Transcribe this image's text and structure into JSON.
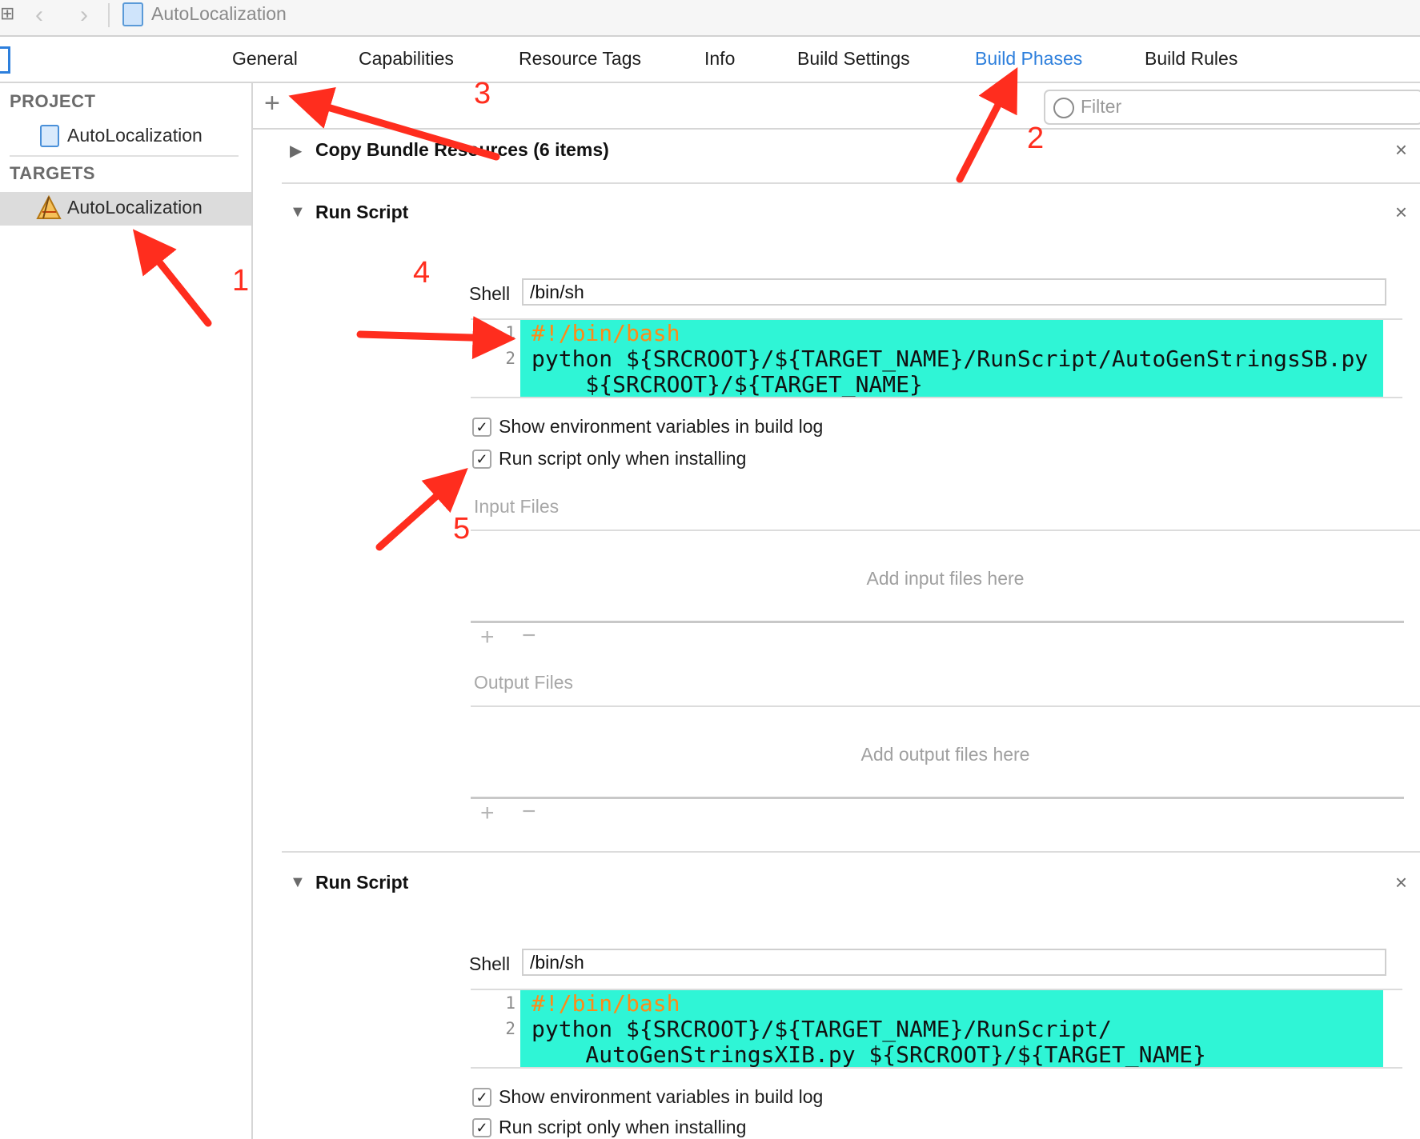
{
  "toolbar": {
    "document_title": "AutoLocalization"
  },
  "tabs": [
    {
      "label": "General"
    },
    {
      "label": "Capabilities"
    },
    {
      "label": "Resource Tags"
    },
    {
      "label": "Info"
    },
    {
      "label": "Build Settings"
    },
    {
      "label": "Build Phases",
      "active": true
    },
    {
      "label": "Build Rules"
    }
  ],
  "sidebar": {
    "project_header": "PROJECT",
    "project_item": "AutoLocalization",
    "targets_header": "TARGETS",
    "target_item": "AutoLocalization"
  },
  "phases_toolbar": {
    "filter_placeholder": "Filter"
  },
  "phases": [
    {
      "title": "Copy Bundle Resources (6 items)",
      "expanded": false
    },
    {
      "title": "Run Script",
      "expanded": true,
      "shell_label": "Shell",
      "shell_value": "/bin/sh",
      "line_numbers": [
        "1",
        "2"
      ],
      "code_lines": [
        "#!/bin/bash",
        "python ${SRCROOT}/${TARGET_NAME}/RunScript/AutoGenStringsSB.py",
        "    ${SRCROOT}/${TARGET_NAME}"
      ],
      "show_env_label": "Show environment variables in build log",
      "show_env_checked": true,
      "install_only_label": "Run script only when installing",
      "install_only_checked": true,
      "input_files_label": "Input Files",
      "input_files_hint": "Add input files here",
      "output_files_label": "Output Files",
      "output_files_hint": "Add output files here"
    },
    {
      "title": "Run Script",
      "expanded": true,
      "shell_label": "Shell",
      "shell_value": "/bin/sh",
      "line_numbers": [
        "1",
        "2"
      ],
      "code_lines": [
        "#!/bin/bash",
        "python ${SRCROOT}/${TARGET_NAME}/RunScript/",
        "    AutoGenStringsXIB.py ${SRCROOT}/${TARGET_NAME}"
      ],
      "show_env_label": "Show environment variables in build log",
      "show_env_checked": true,
      "install_only_label": "Run script only when installing",
      "install_only_checked": true
    }
  ],
  "annotations": [
    "1",
    "2",
    "3",
    "4",
    "5"
  ],
  "colors": {
    "accent": "#2d7fdc",
    "annotation": "#ff2d1e",
    "code_bg": "#2ff5d6",
    "comment": "#ff8a17"
  },
  "icons": [
    "grid-icon",
    "back-chevron-icon",
    "forward-chevron-icon",
    "document-icon",
    "plus-icon",
    "filter-icon",
    "disclosure-triangle-icon",
    "close-icon",
    "app-target-icon",
    "checkmark-icon",
    "minus-icon"
  ]
}
